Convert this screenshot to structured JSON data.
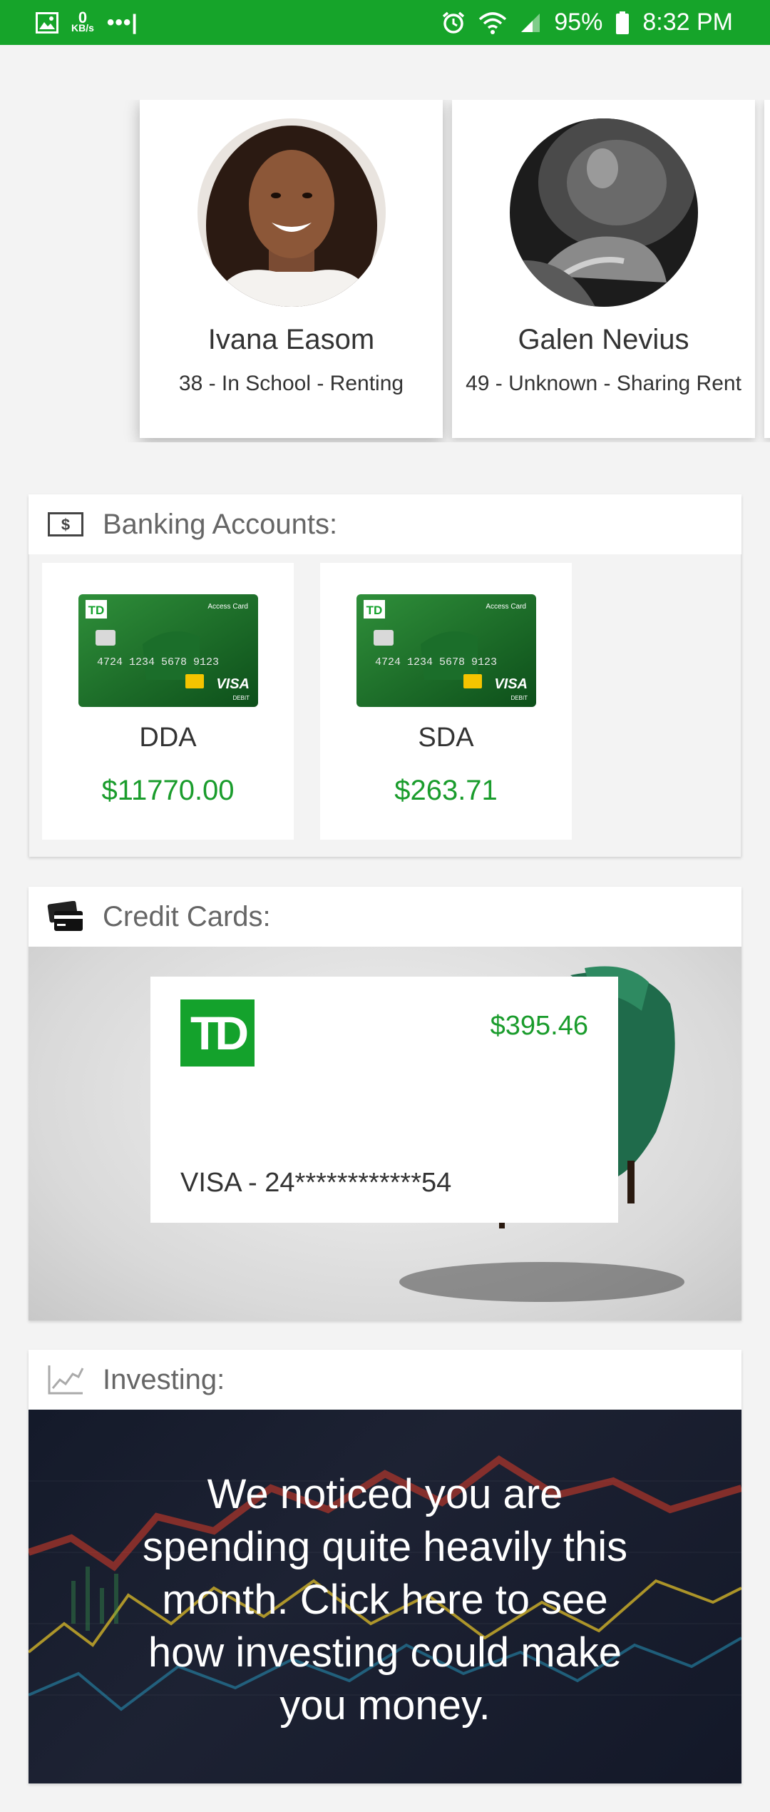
{
  "status_bar": {
    "network_speed_value": "0",
    "network_speed_unit": "KB/s",
    "battery": "95%",
    "time": "8:32 PM"
  },
  "profiles": [
    {
      "name": "Ivana Easom",
      "info": "38 - In School - Renting"
    },
    {
      "name": "Galen Nevius",
      "info": "49 - Unknown - Sharing Rent"
    }
  ],
  "banking": {
    "title": "Banking Accounts:",
    "accounts": [
      {
        "name": "DDA",
        "balance": "$11770.00"
      },
      {
        "name": "SDA",
        "balance": "$263.71"
      }
    ]
  },
  "credit": {
    "title": "Credit Cards:",
    "card": {
      "amount": "$395.46",
      "number": "VISA - 24************54",
      "logo_text": "TD"
    }
  },
  "investing": {
    "title": "Investing:",
    "message": "We noticed you are spending quite heavily this month. Click here to see how investing could make you money."
  },
  "card_image_text": {
    "access_card": "Access Card",
    "number": "4724 1234 5678 9123",
    "brand": "VISA",
    "debit": "DEBIT",
    "logo": "TD"
  },
  "colors": {
    "status_bar": "#16a42a",
    "accent_green": "#1a9c2c",
    "td_green": "#14a22c"
  }
}
